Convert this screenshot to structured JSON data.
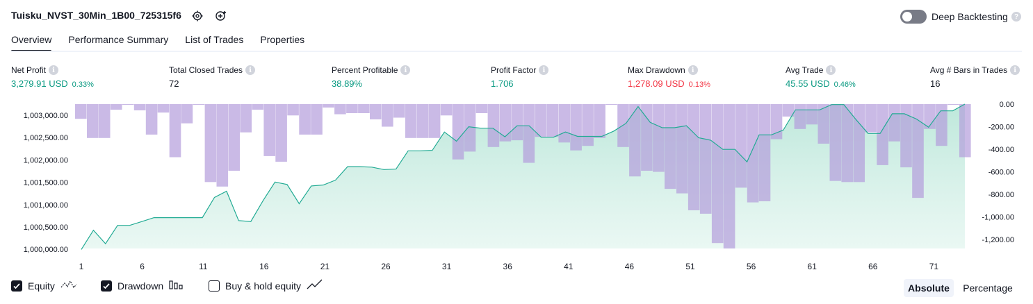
{
  "header": {
    "title": "Tuisku_NVST_30Min_1B00_725315f6",
    "deep_backtesting_label": "Deep Backtesting",
    "deep_backtesting_enabled": false
  },
  "tabs": [
    {
      "label": "Overview",
      "active": true
    },
    {
      "label": "Performance Summary",
      "active": false
    },
    {
      "label": "List of Trades",
      "active": false
    },
    {
      "label": "Properties",
      "active": false
    }
  ],
  "metrics": [
    {
      "label": "Net Profit",
      "value": "3,279.91 USD",
      "pct": "0.33%",
      "color": "#089981"
    },
    {
      "label": "Total Closed Trades",
      "value": "72",
      "pct": "",
      "color": "#131722"
    },
    {
      "label": "Percent Profitable",
      "value": "38.89%",
      "pct": "",
      "color": "#089981"
    },
    {
      "label": "Profit Factor",
      "value": "1.706",
      "pct": "",
      "color": "#089981"
    },
    {
      "label": "Max Drawdown",
      "value": "1,278.09 USD",
      "pct": "0.13%",
      "color": "#f23645"
    },
    {
      "label": "Avg Trade",
      "value": "45.55 USD",
      "pct": "0.46%",
      "color": "#089981"
    },
    {
      "label": "Avg # Bars in Trades",
      "value": "16",
      "pct": "",
      "color": "#131722"
    }
  ],
  "chart_data": {
    "type": "area",
    "x_tick_labels": [
      "1",
      "6",
      "11",
      "16",
      "21",
      "26",
      "31",
      "36",
      "41",
      "46",
      "51",
      "56",
      "61",
      "66",
      "71"
    ],
    "left_axis_ticks": [
      "1,003,000.00",
      "1,002,500.00",
      "1,002,000.00",
      "1,001,500.00",
      "1,001,000.00",
      "1,000,500.00",
      "1,000,000.00"
    ],
    "right_axis_ticks": [
      "0.00",
      "-200.00",
      "-400.00",
      "-600.00",
      "-800.00",
      "-1,000.00",
      "-1,200.00"
    ],
    "equity_ylim": [
      1000000,
      1003000
    ],
    "drawdown_ylim": [
      -1278.09,
      0
    ],
    "trade_numbers": [
      1,
      2,
      3,
      4,
      5,
      6,
      7,
      8,
      9,
      10,
      11,
      12,
      13,
      14,
      15,
      16,
      17,
      18,
      19,
      20,
      21,
      22,
      23,
      24,
      25,
      26,
      27,
      28,
      29,
      30,
      31,
      32,
      33,
      34,
      35,
      36,
      37,
      38,
      39,
      40,
      41,
      42,
      43,
      44,
      45,
      46,
      47,
      48,
      49,
      50,
      51,
      52,
      53,
      54,
      55,
      56,
      57,
      58,
      59,
      60,
      61,
      62,
      63,
      64,
      65,
      66,
      67,
      68,
      69,
      70,
      71,
      72,
      73
    ],
    "series": [
      {
        "name": "Equity",
        "color": "#22ab94",
        "values": [
          999980,
          1000380,
          1000100,
          1000480,
          1000480,
          1000560,
          1000640,
          1000640,
          1000640,
          1000640,
          1000640,
          1001060,
          1001190,
          1000580,
          1000560,
          1000990,
          1001380,
          1001330,
          1000930,
          1001300,
          1001320,
          1001420,
          1001700,
          1001700,
          1001690,
          1001640,
          1001650,
          1002030,
          1002030,
          1002040,
          1002420,
          1002230,
          1002530,
          1002500,
          1002500,
          1002320,
          1002550,
          1002550,
          1002310,
          1002310,
          1002420,
          1002330,
          1002330,
          1002330,
          1002440,
          1002600,
          1002950,
          1002620,
          1002510,
          1002510,
          1002550,
          1002300,
          1002250,
          1002060,
          1002060,
          1001800,
          1002360,
          1002360,
          1002460,
          1002880,
          1002880,
          1002880,
          1002990,
          1002990,
          1002680,
          1002390,
          1002390,
          1002800,
          1002800,
          1002690,
          1002520,
          1002860,
          1002860,
          1003000
        ]
      },
      {
        "name": "Drawdown",
        "color": "#b39ddb",
        "values": [
          -130,
          -300,
          -300,
          -50,
          0,
          -55,
          -270,
          -75,
          -470,
          -170,
          0,
          -690,
          -730,
          -590,
          -250,
          -50,
          -460,
          -510,
          -100,
          -270,
          -270,
          -30,
          -90,
          -80,
          -80,
          -135,
          -200,
          -120,
          -300,
          -300,
          -300,
          -100,
          -490,
          -420,
          -80,
          -380,
          -330,
          -320,
          -520,
          -290,
          -290,
          -340,
          -410,
          -370,
          -300,
          0,
          -380,
          -640,
          -590,
          -600,
          -750,
          -790,
          -940,
          -970,
          -1230,
          -1278,
          -740,
          -870,
          -860,
          -310,
          -110,
          -220,
          -180,
          -350,
          -680,
          -690,
          -690,
          -250,
          -540,
          -330,
          -560,
          -830,
          -220,
          -370,
          0,
          -470
        ]
      }
    ],
    "legend": [
      {
        "label": "Equity",
        "checked": true
      },
      {
        "label": "Drawdown",
        "checked": true
      },
      {
        "label": "Buy & hold equity",
        "checked": false
      }
    ]
  },
  "view_toggle": {
    "absolute_label": "Absolute",
    "percentage_label": "Percentage",
    "selected": "Absolute"
  }
}
